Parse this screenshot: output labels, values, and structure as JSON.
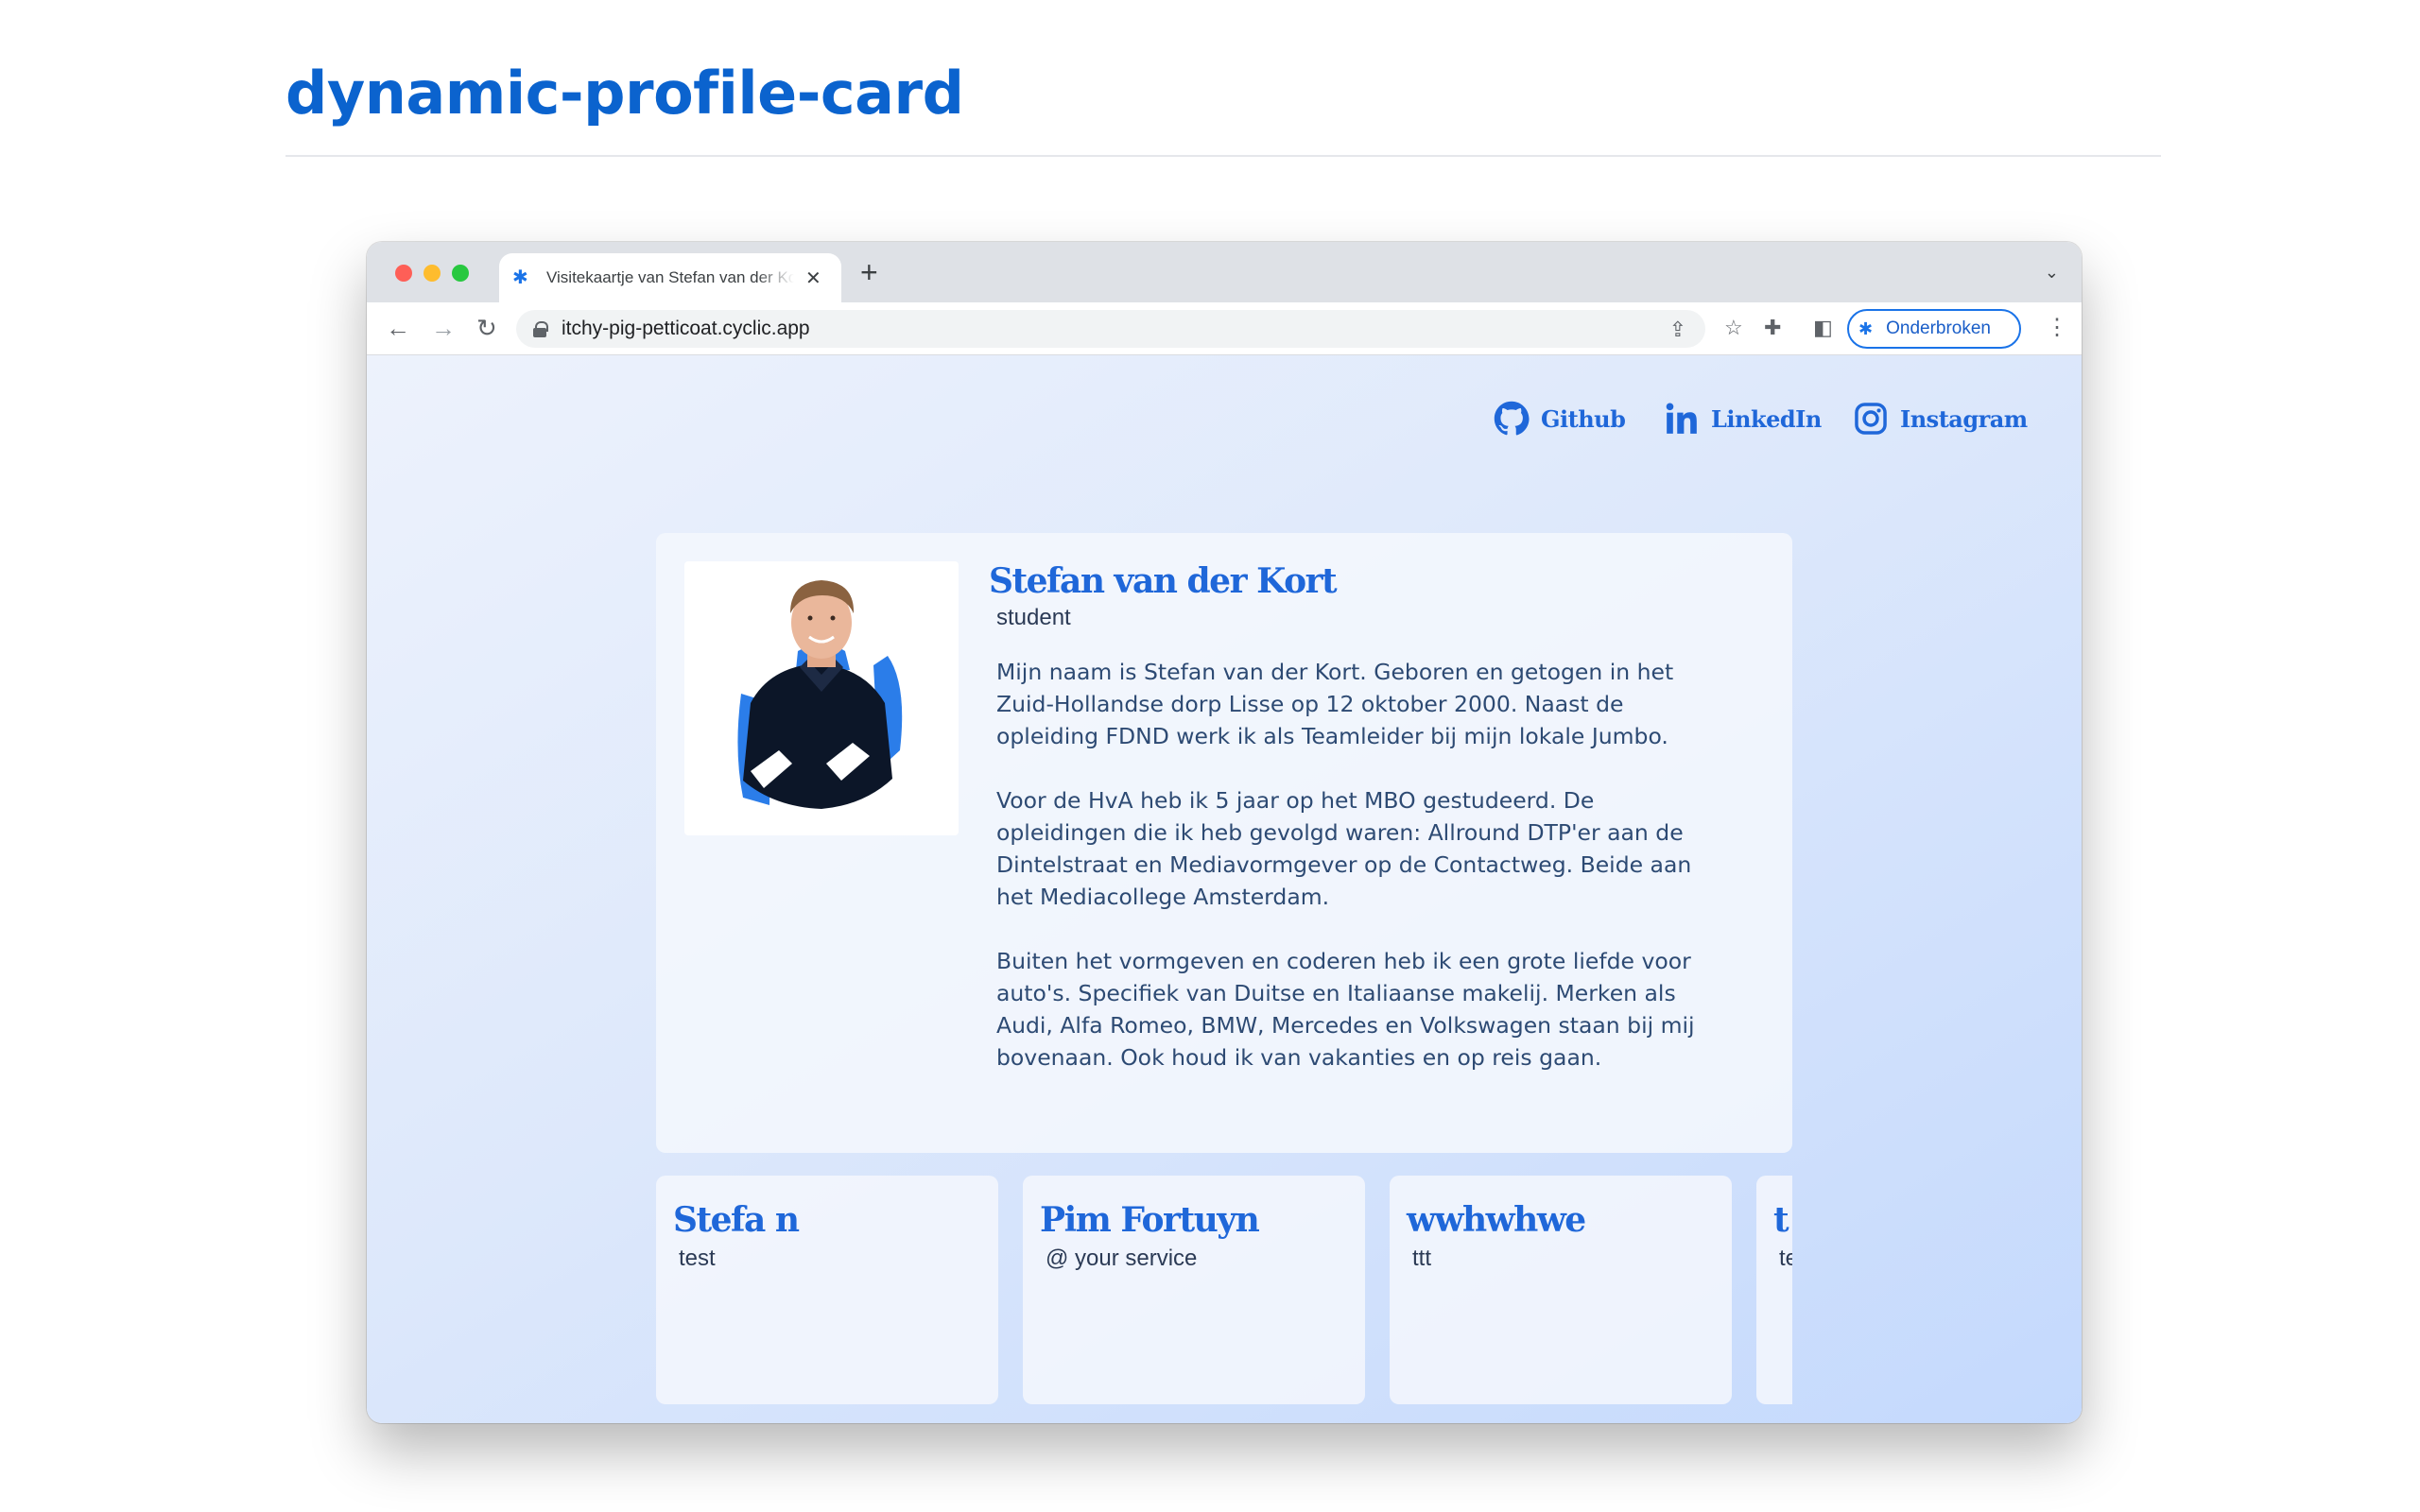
{
  "page": {
    "title": "dynamic-profile-card"
  },
  "browser": {
    "tab": {
      "title": "Visitekaartje van Stefan van der Kort"
    },
    "url": "itchy-pig-petticoat.cyclic.app",
    "profile_label": "Onderbroken"
  },
  "social_links": [
    {
      "label": "Github",
      "icon": "github-icon"
    },
    {
      "label": "LinkedIn",
      "icon": "linkedin-icon"
    },
    {
      "label": "Instagram",
      "icon": "instagram-icon"
    }
  ],
  "profile": {
    "name": "Stefan van der Kort",
    "role": "student",
    "bio": [
      "Mijn naam is Stefan van der Kort. Geboren en getogen in het Zuid-Hollandse dorp Lisse op 12 oktober 2000. Naast de opleiding FDND werk ik als Teamleider bij mijn lokale Jumbo.",
      "Voor de HvA heb ik 5 jaar op het MBO gestudeerd. De opleidingen die ik heb gevolgd waren: Allround DTP'er aan de Dintelstraat en Mediavormgever op de Contactweg. Beide aan het Mediacollege Amsterdam.",
      "Buiten het vormgeven en coderen heb ik een grote liefde voor auto's. Specifiek van Duitse en Italiaanse makelij. Merken als Audi, Alfa Romeo, BMW, Mercedes en Volkswagen staan bij mij bovenaan. Ook houd ik van vakanties en op reis gaan."
    ]
  },
  "cards": [
    {
      "name": "Stefa n",
      "role": "test"
    },
    {
      "name": "Pim Fortuyn",
      "role": "@ your service"
    },
    {
      "name": "wwhwhwe",
      "role": "ttt"
    },
    {
      "name": "t",
      "role": "te"
    }
  ],
  "colors": {
    "accent": "#1f67d9",
    "title": "#0b63ce",
    "body_text": "#2d4a73"
  }
}
